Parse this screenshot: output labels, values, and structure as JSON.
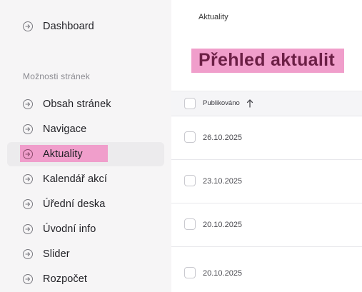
{
  "sidebar": {
    "top_item": {
      "label": "Dashboard",
      "icon": "arrow-circle-right-icon"
    },
    "section_heading": "Možnosti stránek",
    "items": [
      {
        "label": "Obsah stránek",
        "icon": "arrow-circle-right-icon"
      },
      {
        "label": "Navigace",
        "icon": "arrow-circle-right-icon"
      },
      {
        "label": "Aktuality",
        "icon": "arrow-circle-right-icon",
        "active": true
      },
      {
        "label": "Kalendář akcí",
        "icon": "arrow-circle-right-icon"
      },
      {
        "label": "Úřední deska",
        "icon": "arrow-circle-right-icon"
      },
      {
        "label": "Úvodní info",
        "icon": "arrow-circle-right-icon"
      },
      {
        "label": "Slider",
        "icon": "arrow-circle-right-icon"
      },
      {
        "label": "Rozpočet",
        "icon": "arrow-circle-right-icon"
      }
    ]
  },
  "main": {
    "breadcrumb": "Aktuality",
    "title": "Přehled aktualit",
    "table": {
      "columns": [
        {
          "label": "Publikováno",
          "sort": "ascending"
        }
      ],
      "rows": [
        {
          "published": "26.10.2025"
        },
        {
          "published": "23.10.2025"
        },
        {
          "published": "20.10.2025"
        },
        {
          "published": "20.10.2025"
        }
      ]
    }
  },
  "colors": {
    "highlight": "#f09ecb",
    "title": "#6b1f45",
    "sidebar_bg": "#f6f5f6",
    "active_item_bg": "#ecebed"
  }
}
